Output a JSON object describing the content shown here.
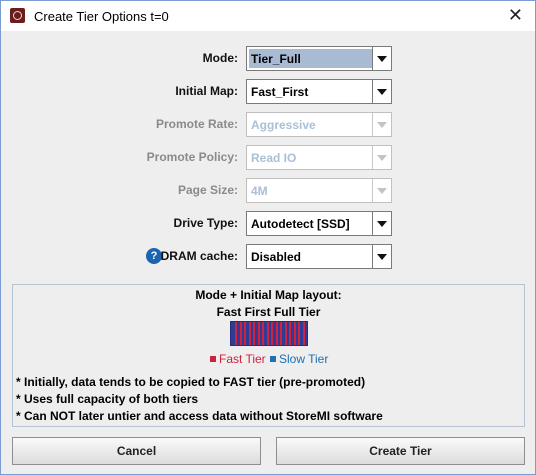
{
  "window": {
    "title": "Create Tier Options t=0",
    "close_glyph": "✕"
  },
  "form": [
    {
      "label": "Mode:",
      "value": "Tier_Full",
      "enabled": true,
      "selected": true
    },
    {
      "label": "Initial Map:",
      "value": "Fast_First",
      "enabled": true,
      "selected": false
    },
    {
      "label": "Promote Rate:",
      "value": "Aggressive",
      "enabled": false,
      "selected": false
    },
    {
      "label": "Promote Policy:",
      "value": "Read IO",
      "enabled": false,
      "selected": false
    },
    {
      "label": "Page Size:",
      "value": "4M",
      "enabled": false,
      "selected": false
    },
    {
      "label": "Drive Type:",
      "value": "Autodetect [SSD]",
      "enabled": true,
      "selected": false
    },
    {
      "label": "DRAM cache:",
      "value": "Disabled",
      "enabled": true,
      "selected": false,
      "help_glyph": "?"
    }
  ],
  "layout_panel": {
    "title": "Mode + Initial Map layout:",
    "layout_name": "Fast First Full Tier",
    "legend": [
      {
        "label": "Fast Tier",
        "color": "#cf2140"
      },
      {
        "label": "Slow Tier",
        "color": "#1f6fb3"
      }
    ],
    "notes": [
      "* Initially, data tends to be copied to FAST tier (pre-promoted)",
      "* Uses full capacity of both tiers",
      "* Can NOT later untier and access data without StoreMI software"
    ]
  },
  "buttons": {
    "cancel": "Cancel",
    "create": "Create Tier"
  },
  "colors": {
    "fast_tier": "#cf2140",
    "slow_tier": "#2e3c95",
    "selection": "#a9bad3"
  }
}
